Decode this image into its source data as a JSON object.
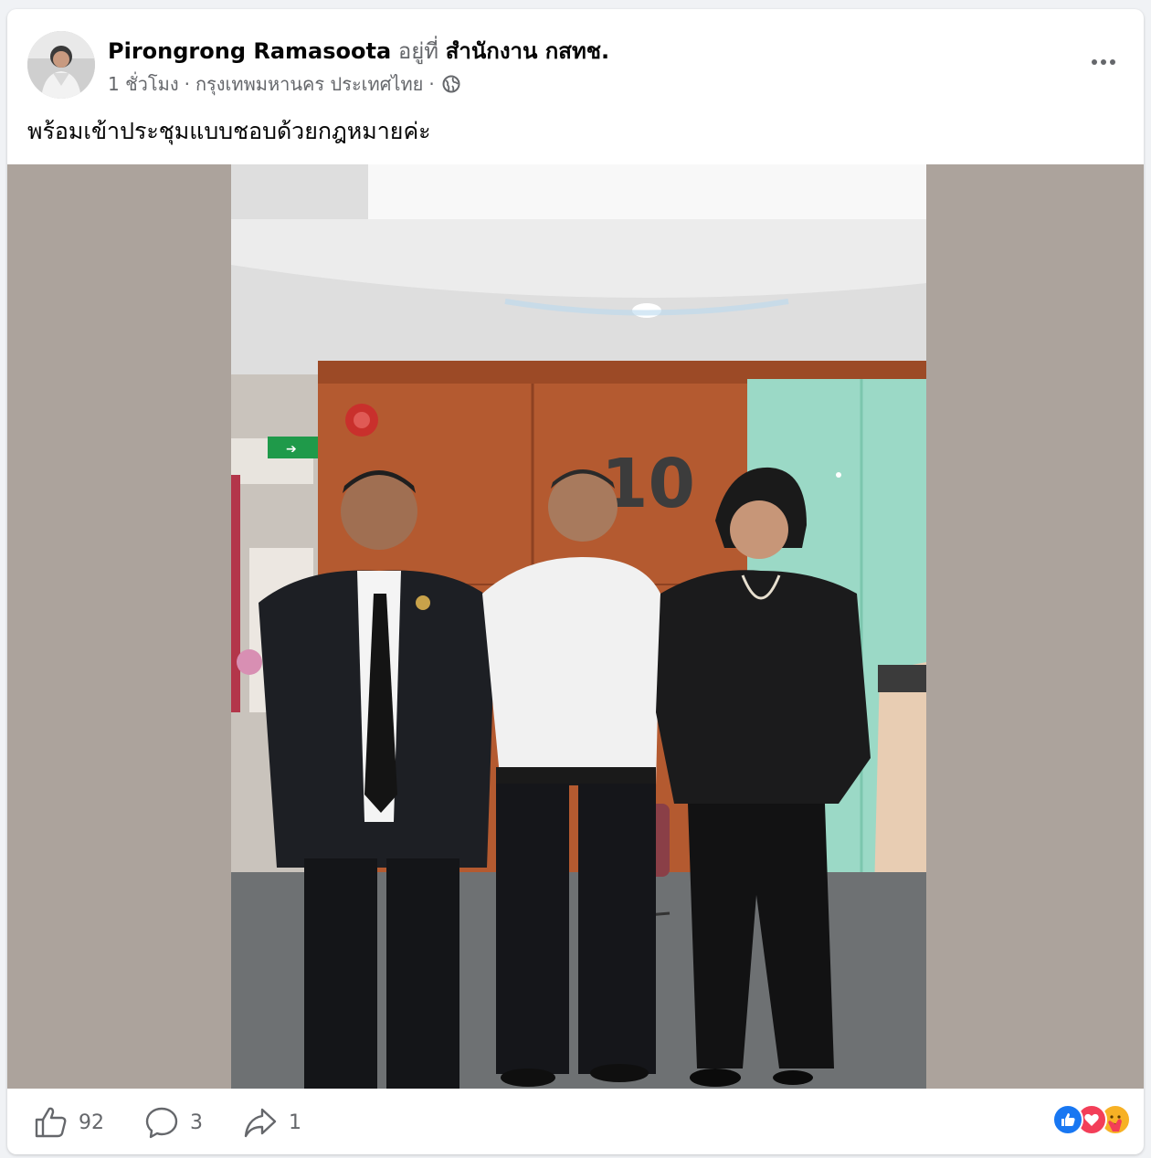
{
  "post": {
    "author_name": "Pirongrong Ramasoota",
    "at_word": "อยู่ที่",
    "place": "สำนักงาน กสทช.",
    "time": "1 ชั่วโมง",
    "separator": "·",
    "location": "กรุงเทพมหานคร ประเทศไทย",
    "audience_icon": "globe-icon",
    "text": "พร้อมเข้าประชุมแบบชอบด้วยกฎหมายค่ะ"
  },
  "photo": {
    "wall_number": "10"
  },
  "actions": {
    "like_count": "92",
    "comment_count": "3",
    "share_count": "1"
  },
  "reactions": [
    "like-reaction-icon",
    "love-reaction-icon",
    "care-reaction-icon"
  ],
  "colors": {
    "like_blue": "#1877f2",
    "love_red": "#f33e58",
    "care_yellow": "#f7b125",
    "secondary_text": "#65676b"
  }
}
